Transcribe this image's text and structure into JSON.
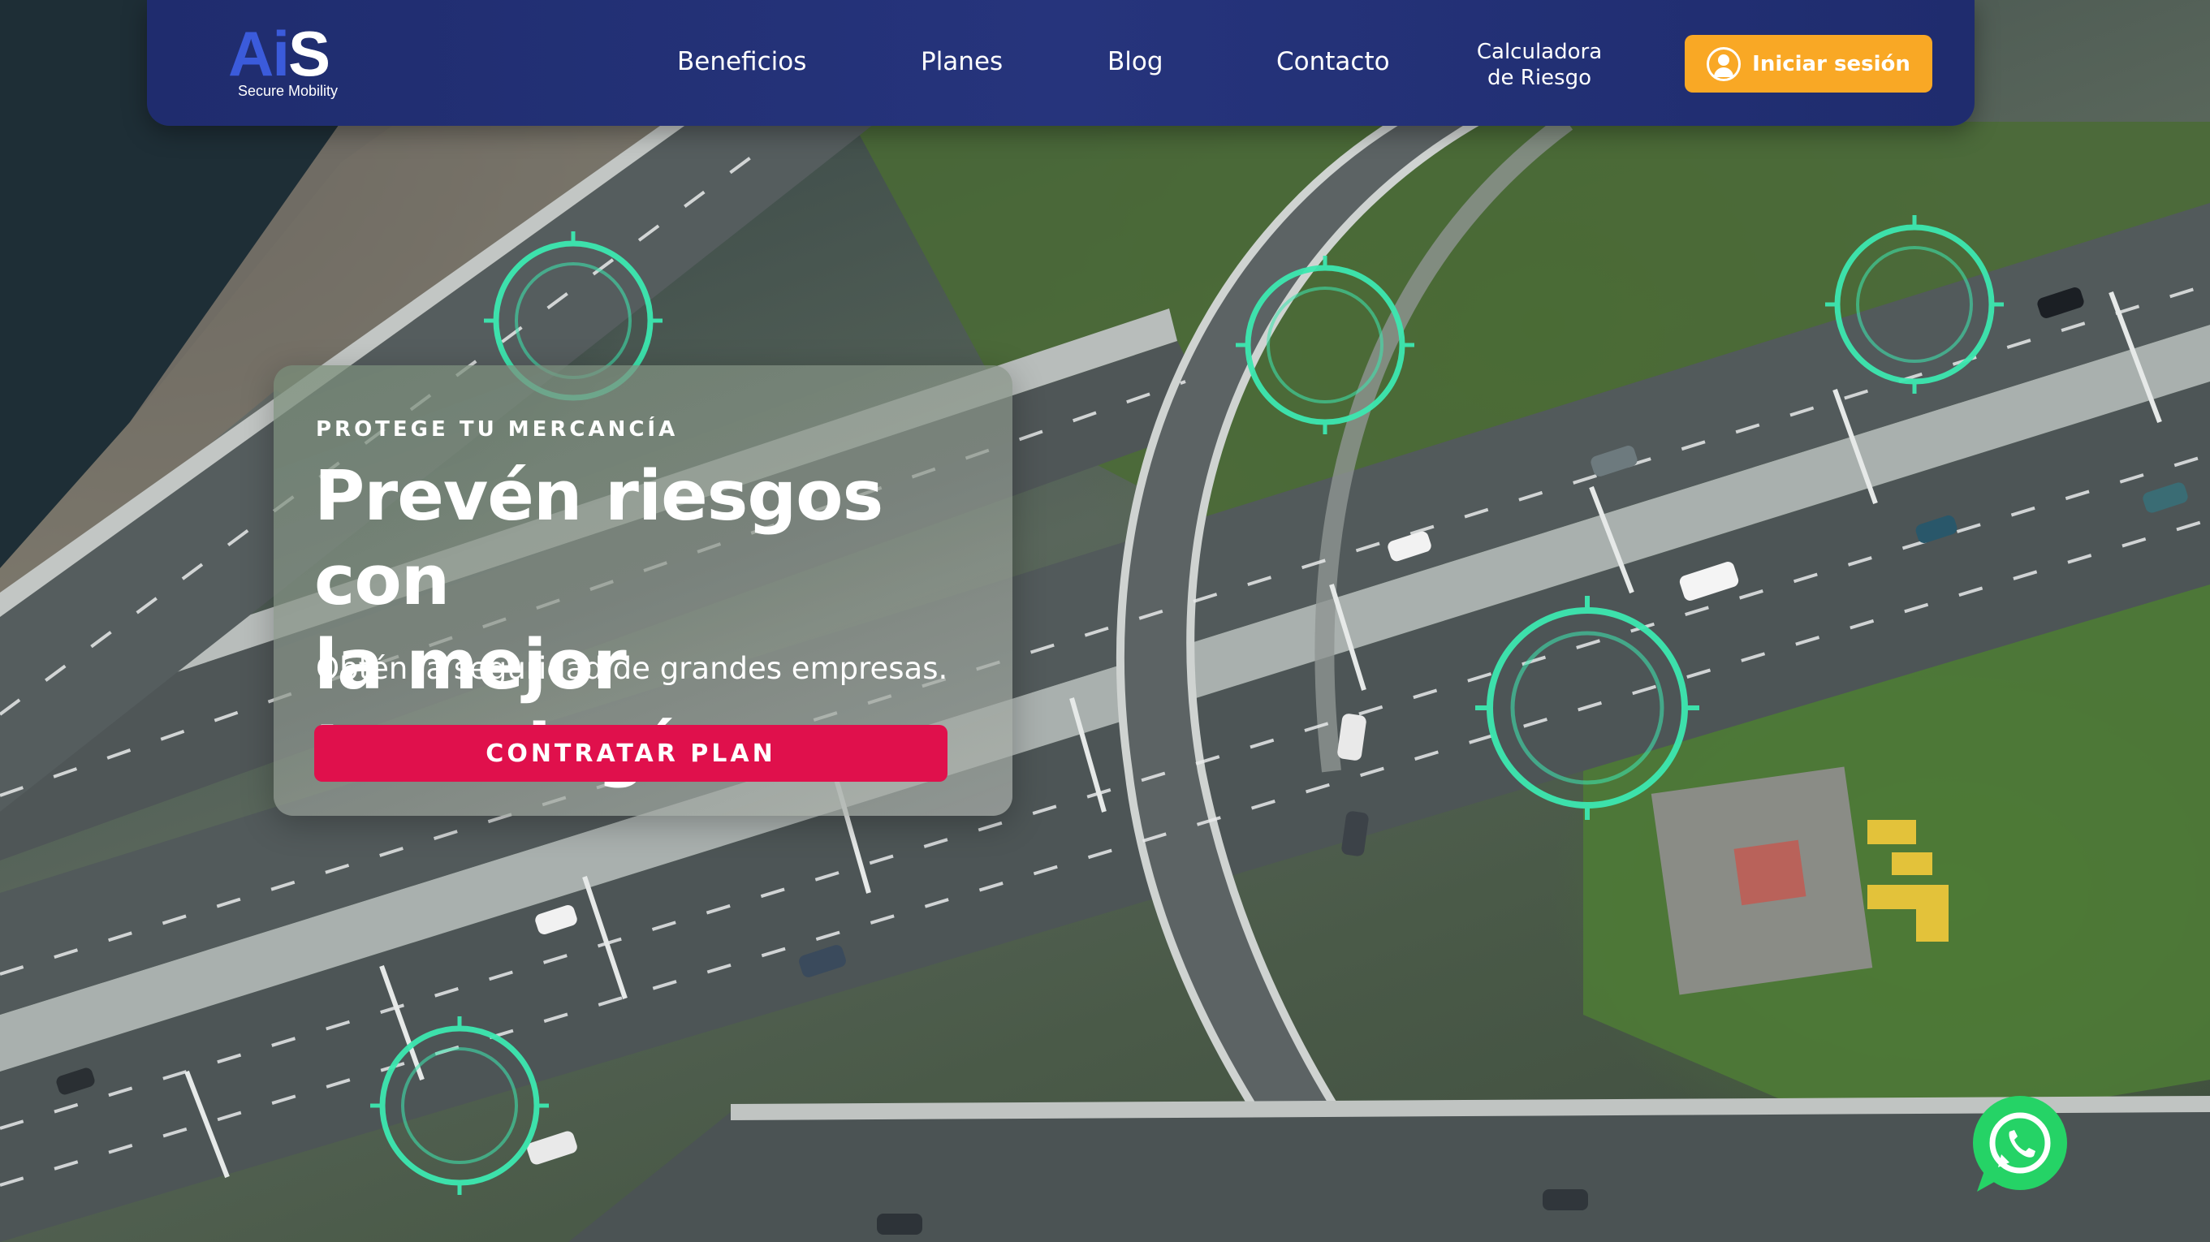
{
  "brand": {
    "logo_text": "AiS",
    "tagline": "Secure Mobility"
  },
  "nav": {
    "items": [
      {
        "label": "Beneficios"
      },
      {
        "label": "Planes"
      },
      {
        "label": "Blog"
      },
      {
        "label": "Contacto"
      },
      {
        "label": "Calculadora de Riesgo"
      }
    ],
    "login_label": "Iniciar sesión",
    "login_icon": "user-circle-icon",
    "accent": "#f9a825",
    "bar_color": "#232f75"
  },
  "hero": {
    "eyebrow": "PROTEGE TU MERCANCÍA",
    "headline_line1": "Prevén riesgos con",
    "headline_line2": "la mejor tecnología",
    "subheadline": "Obtén la seguridad de grandes empresas.",
    "cta_label": "CONTRATAR PLAN",
    "cta_color": "#e0104c"
  },
  "floating": {
    "whatsapp_icon": "whatsapp-icon",
    "whatsapp_color": "#25d366"
  },
  "background": {
    "scene": "aerial-highway-interchange",
    "tracking_marker_color": "#3de8b0"
  }
}
